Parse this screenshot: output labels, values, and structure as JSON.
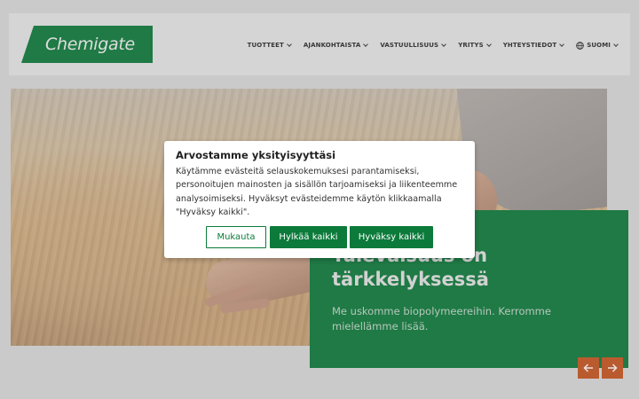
{
  "header": {
    "logo_text": "Chemigate",
    "nav": [
      {
        "label": "TUOTTEET"
      },
      {
        "label": "AJANKOHTAISTA"
      },
      {
        "label": "VASTUULLISUUS"
      },
      {
        "label": "YRITYS"
      },
      {
        "label": "YHTEYSTIEDOT"
      },
      {
        "label": "SUOMI"
      }
    ]
  },
  "promo": {
    "title": "Tulevaisuus on tärkkelyksessä",
    "text": "Me uskomme biopolymeereihin. Kerromme mielellämme lisää."
  },
  "cookie_dialog": {
    "title": "Arvostamme yksityisyyttäsi",
    "body": "Käytämme evästeitä selauskokemuksesi parantamiseksi, personoitujen mainosten ja sisällön tarjoamiseksi ja liikenteemme analysoimiseksi. Hyväksyt evästeidemme käytön klikkaamalla \"Hyväksy kaikki\".",
    "customize_label": "Mukauta",
    "reject_label": "Hylkää kaikki",
    "accept_label": "Hyväksy kaikki"
  },
  "colors": {
    "brand_green": "#0b7a3a",
    "arrow_orange": "#c8531f"
  },
  "icons": {
    "nav_chevron": "chevron-down-icon",
    "language": "globe-icon",
    "prev": "arrow-left-icon",
    "next": "arrow-right-icon"
  }
}
